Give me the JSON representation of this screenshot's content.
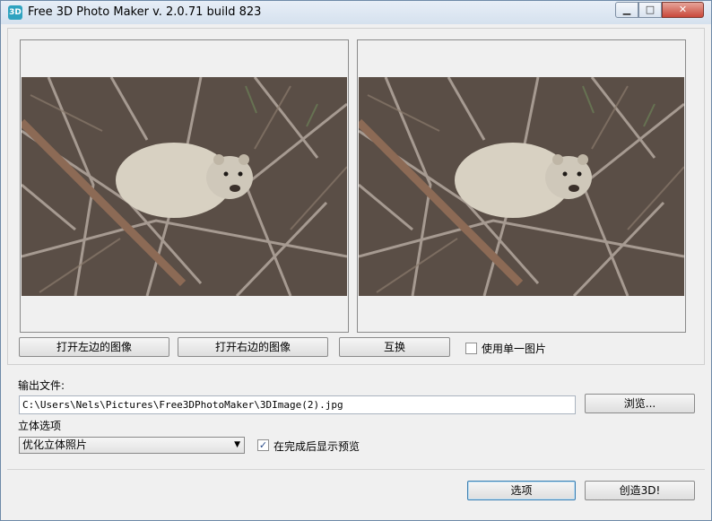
{
  "window": {
    "title": "Free 3D Photo Maker  v. 2.0.71 build 823",
    "app_icon_text": "3D",
    "minimize_glyph": "▁",
    "maximize_glyph": "□",
    "close_glyph": "✕"
  },
  "images": {
    "left_alt": "rock hyrax on branches (left image)",
    "right_alt": "rock hyrax on branches (right image)"
  },
  "buttons": {
    "open_left": "打开左边的图像",
    "open_right": "打开右边的图像",
    "swap": "互换",
    "browse": "浏览...",
    "options": "选项",
    "create": "创造3D!"
  },
  "single_image": {
    "label": "使用单一图片",
    "checked": false
  },
  "output": {
    "label": "输出文件:",
    "path": "C:\\Users\\Nels\\Pictures\\Free3DPhotoMaker\\3DImage(2).jpg"
  },
  "stereo": {
    "label": "立体选项",
    "selected": "优化立体照片",
    "show_preview_label": "在完成后显示预览",
    "show_preview_checked": true
  },
  "colors": {
    "title_bg": "#dbe6f2",
    "accent": "#3c7fb1"
  }
}
